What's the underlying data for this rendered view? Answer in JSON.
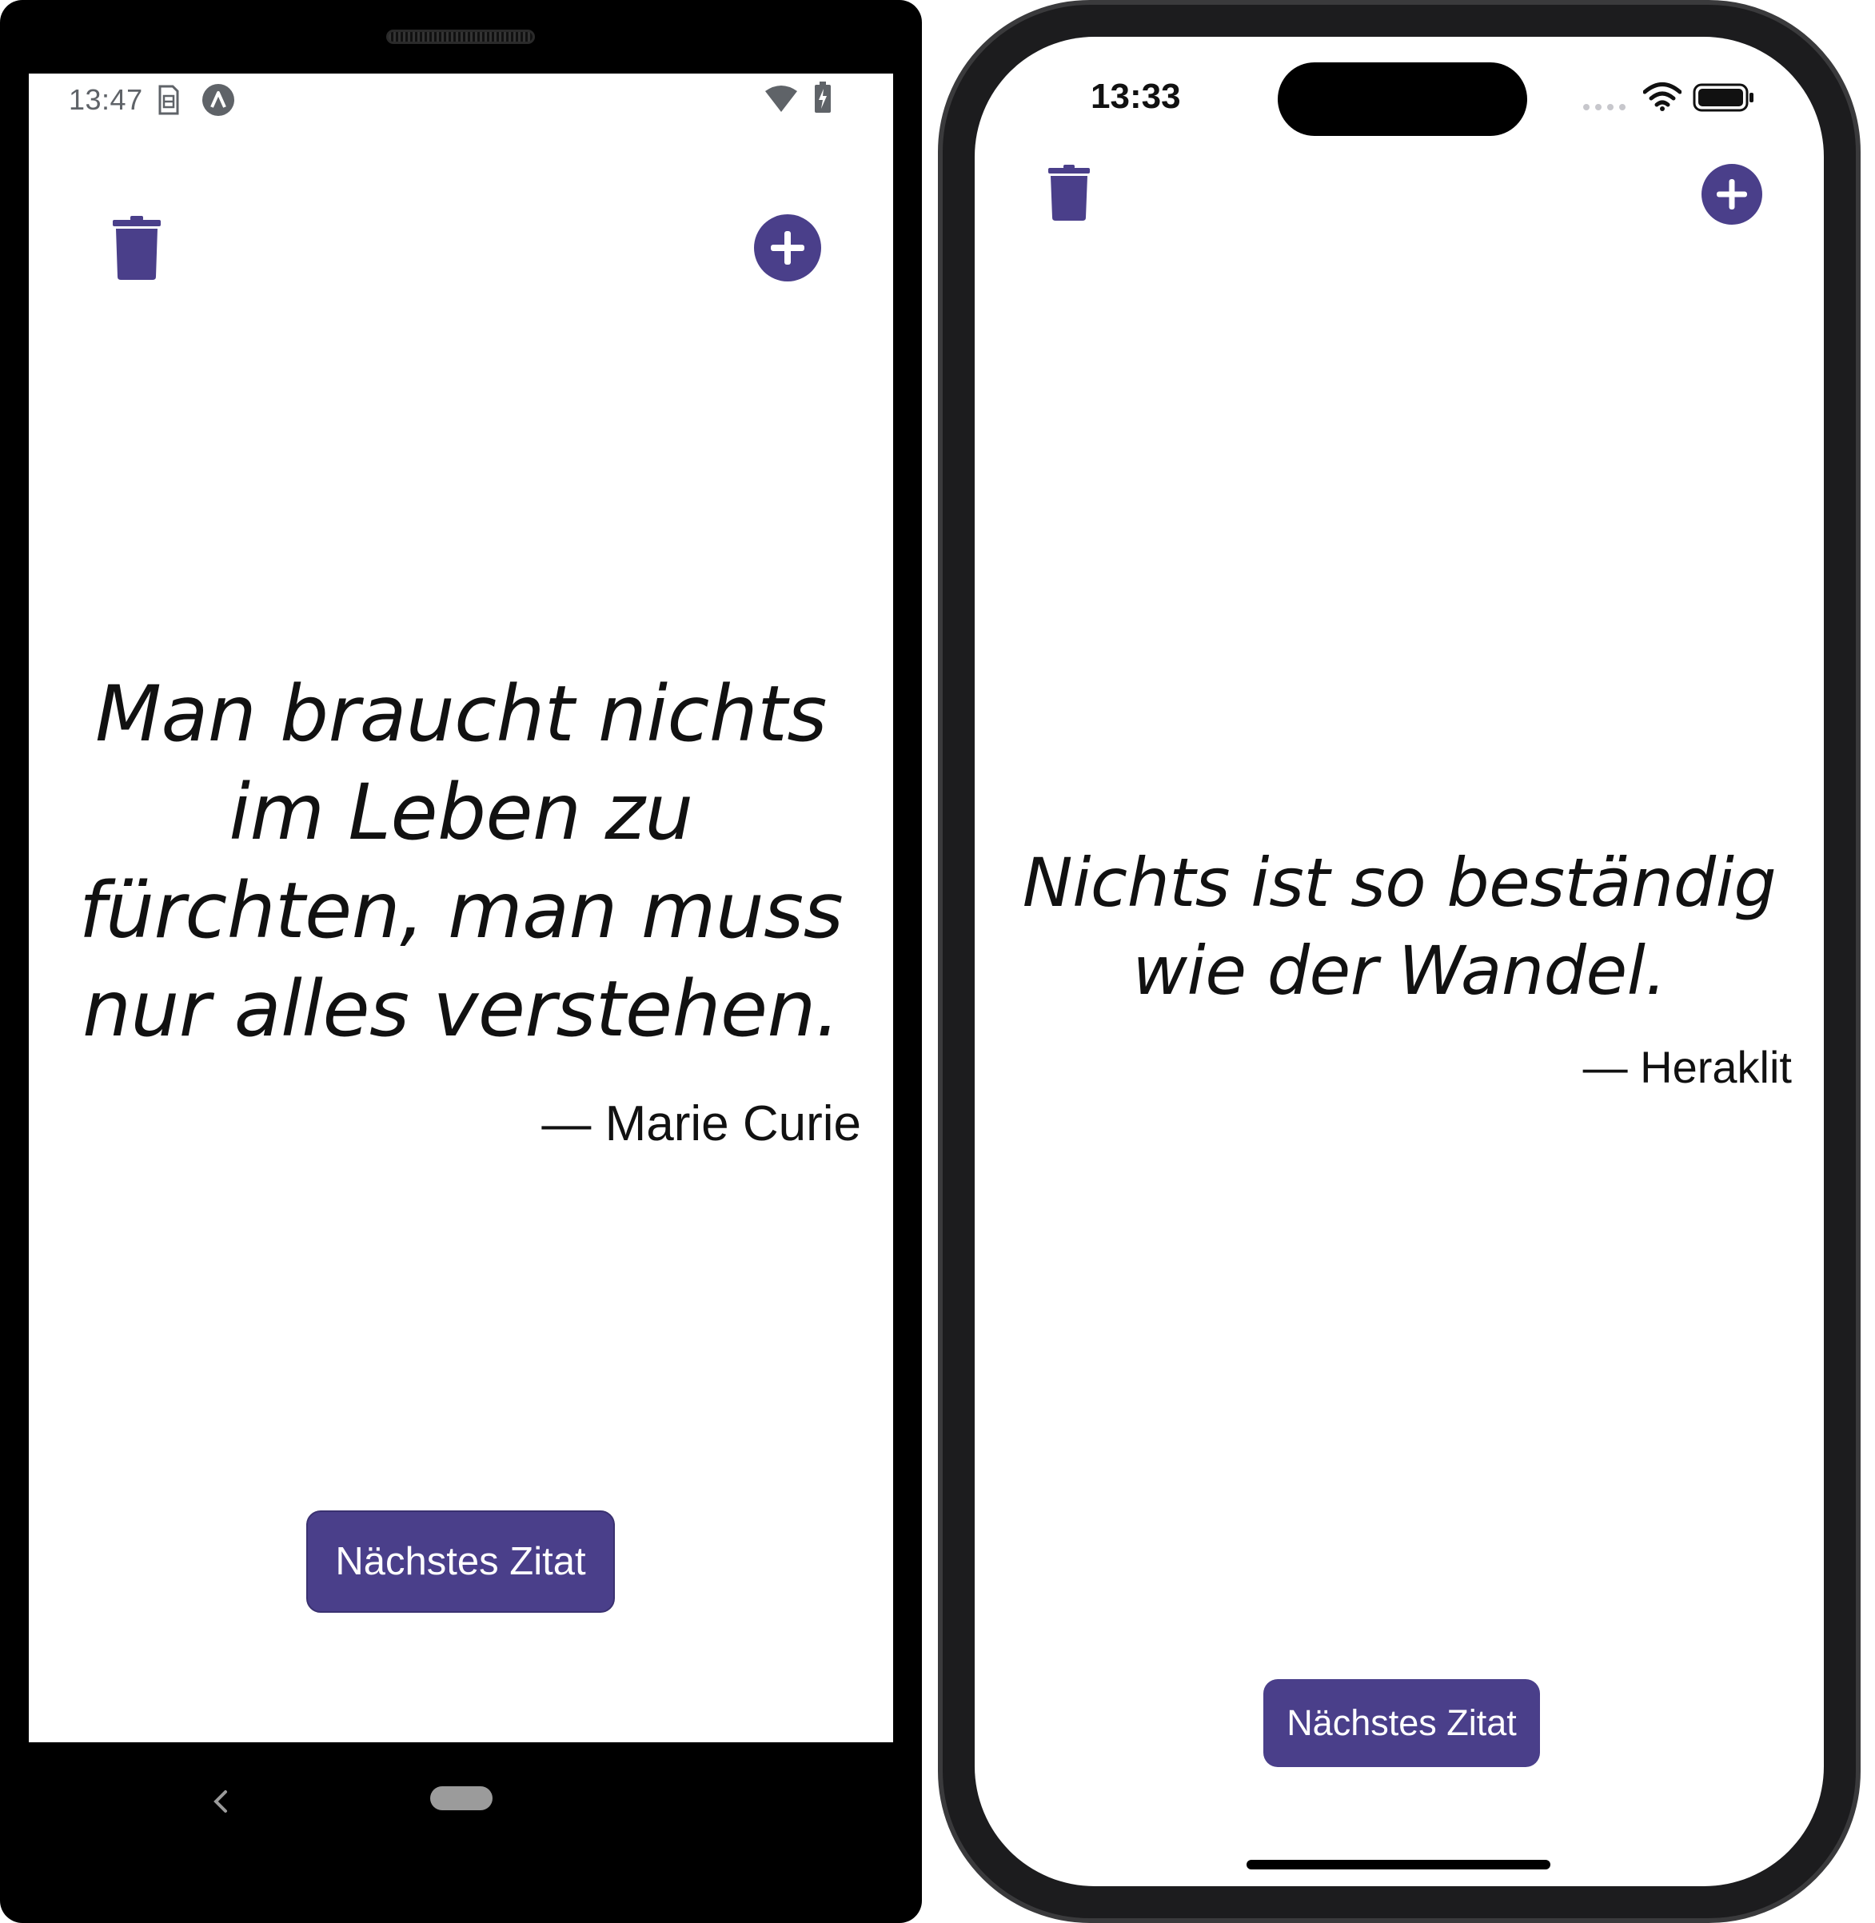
{
  "android": {
    "status_bar": {
      "time": "13:47",
      "icons": [
        "sim-icon",
        "app-notification-icon",
        "wifi-icon",
        "battery-charging-icon"
      ]
    },
    "toolbar": {
      "delete_icon": "trash-icon",
      "add_icon": "plus-circle-icon"
    },
    "quote": {
      "text": "Man braucht nichts im Leben zu fürchten, man muss nur alles verstehen.",
      "author": "— Marie Curie"
    },
    "next_button_label": "Nächstes Zitat",
    "nav_bar": {
      "icons": [
        "back-icon",
        "home-pill-icon"
      ]
    }
  },
  "ios": {
    "status_bar": {
      "time": "13:33",
      "icons": [
        "cellular-signal-icon",
        "wifi-icon",
        "battery-icon"
      ]
    },
    "toolbar": {
      "delete_icon": "trash-icon",
      "add_icon": "plus-circle-icon"
    },
    "quote": {
      "text": "Nichts ist so beständig wie der Wandel.",
      "author": "— Heraklit"
    },
    "next_button_label": "Nächstes Zitat"
  },
  "colors": {
    "accent": "#4a3f8a",
    "text": "#111111",
    "background": "#ffffff"
  }
}
